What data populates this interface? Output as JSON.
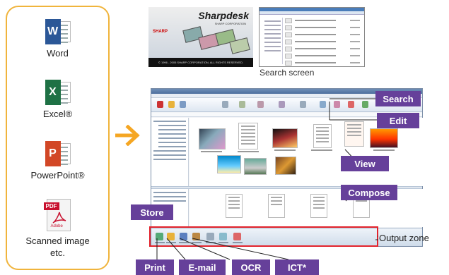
{
  "sources": {
    "items": [
      {
        "label": "Word",
        "badge": "W"
      },
      {
        "label": "Excel®",
        "badge": "X"
      },
      {
        "label": "PowerPoint®",
        "badge": "P"
      },
      {
        "label": "Scanned image etc.",
        "line1": "Scanned image",
        "line2": "etc.",
        "pdf_tag": "PDF",
        "adobe_text": "Adobe"
      }
    ]
  },
  "splash": {
    "title": "Sharpdesk",
    "subtitle": "SHARP CORPORATION",
    "brand": "SHARP",
    "footer": "© 1996 - 2005 SHARP CORPORATION, ALL RIGHTS RESERVED."
  },
  "search_caption": "Search screen",
  "callouts": {
    "search": "Search",
    "edit": "Edit",
    "view": "View",
    "compose": "Compose",
    "store": "Store",
    "print": "Print",
    "email": "E-mail",
    "ocr": "OCR",
    "ict": "ICT*"
  },
  "output_zone_label": "Output zone",
  "colors": {
    "panel_border": "#f0b43c",
    "arrow": "#f5a623",
    "callout_bg": "#66409a",
    "output_frame": "#e3232c"
  },
  "icons": [
    "word-icon",
    "excel-icon",
    "powerpoint-icon",
    "pdf-icon",
    "right-arrow-icon"
  ]
}
